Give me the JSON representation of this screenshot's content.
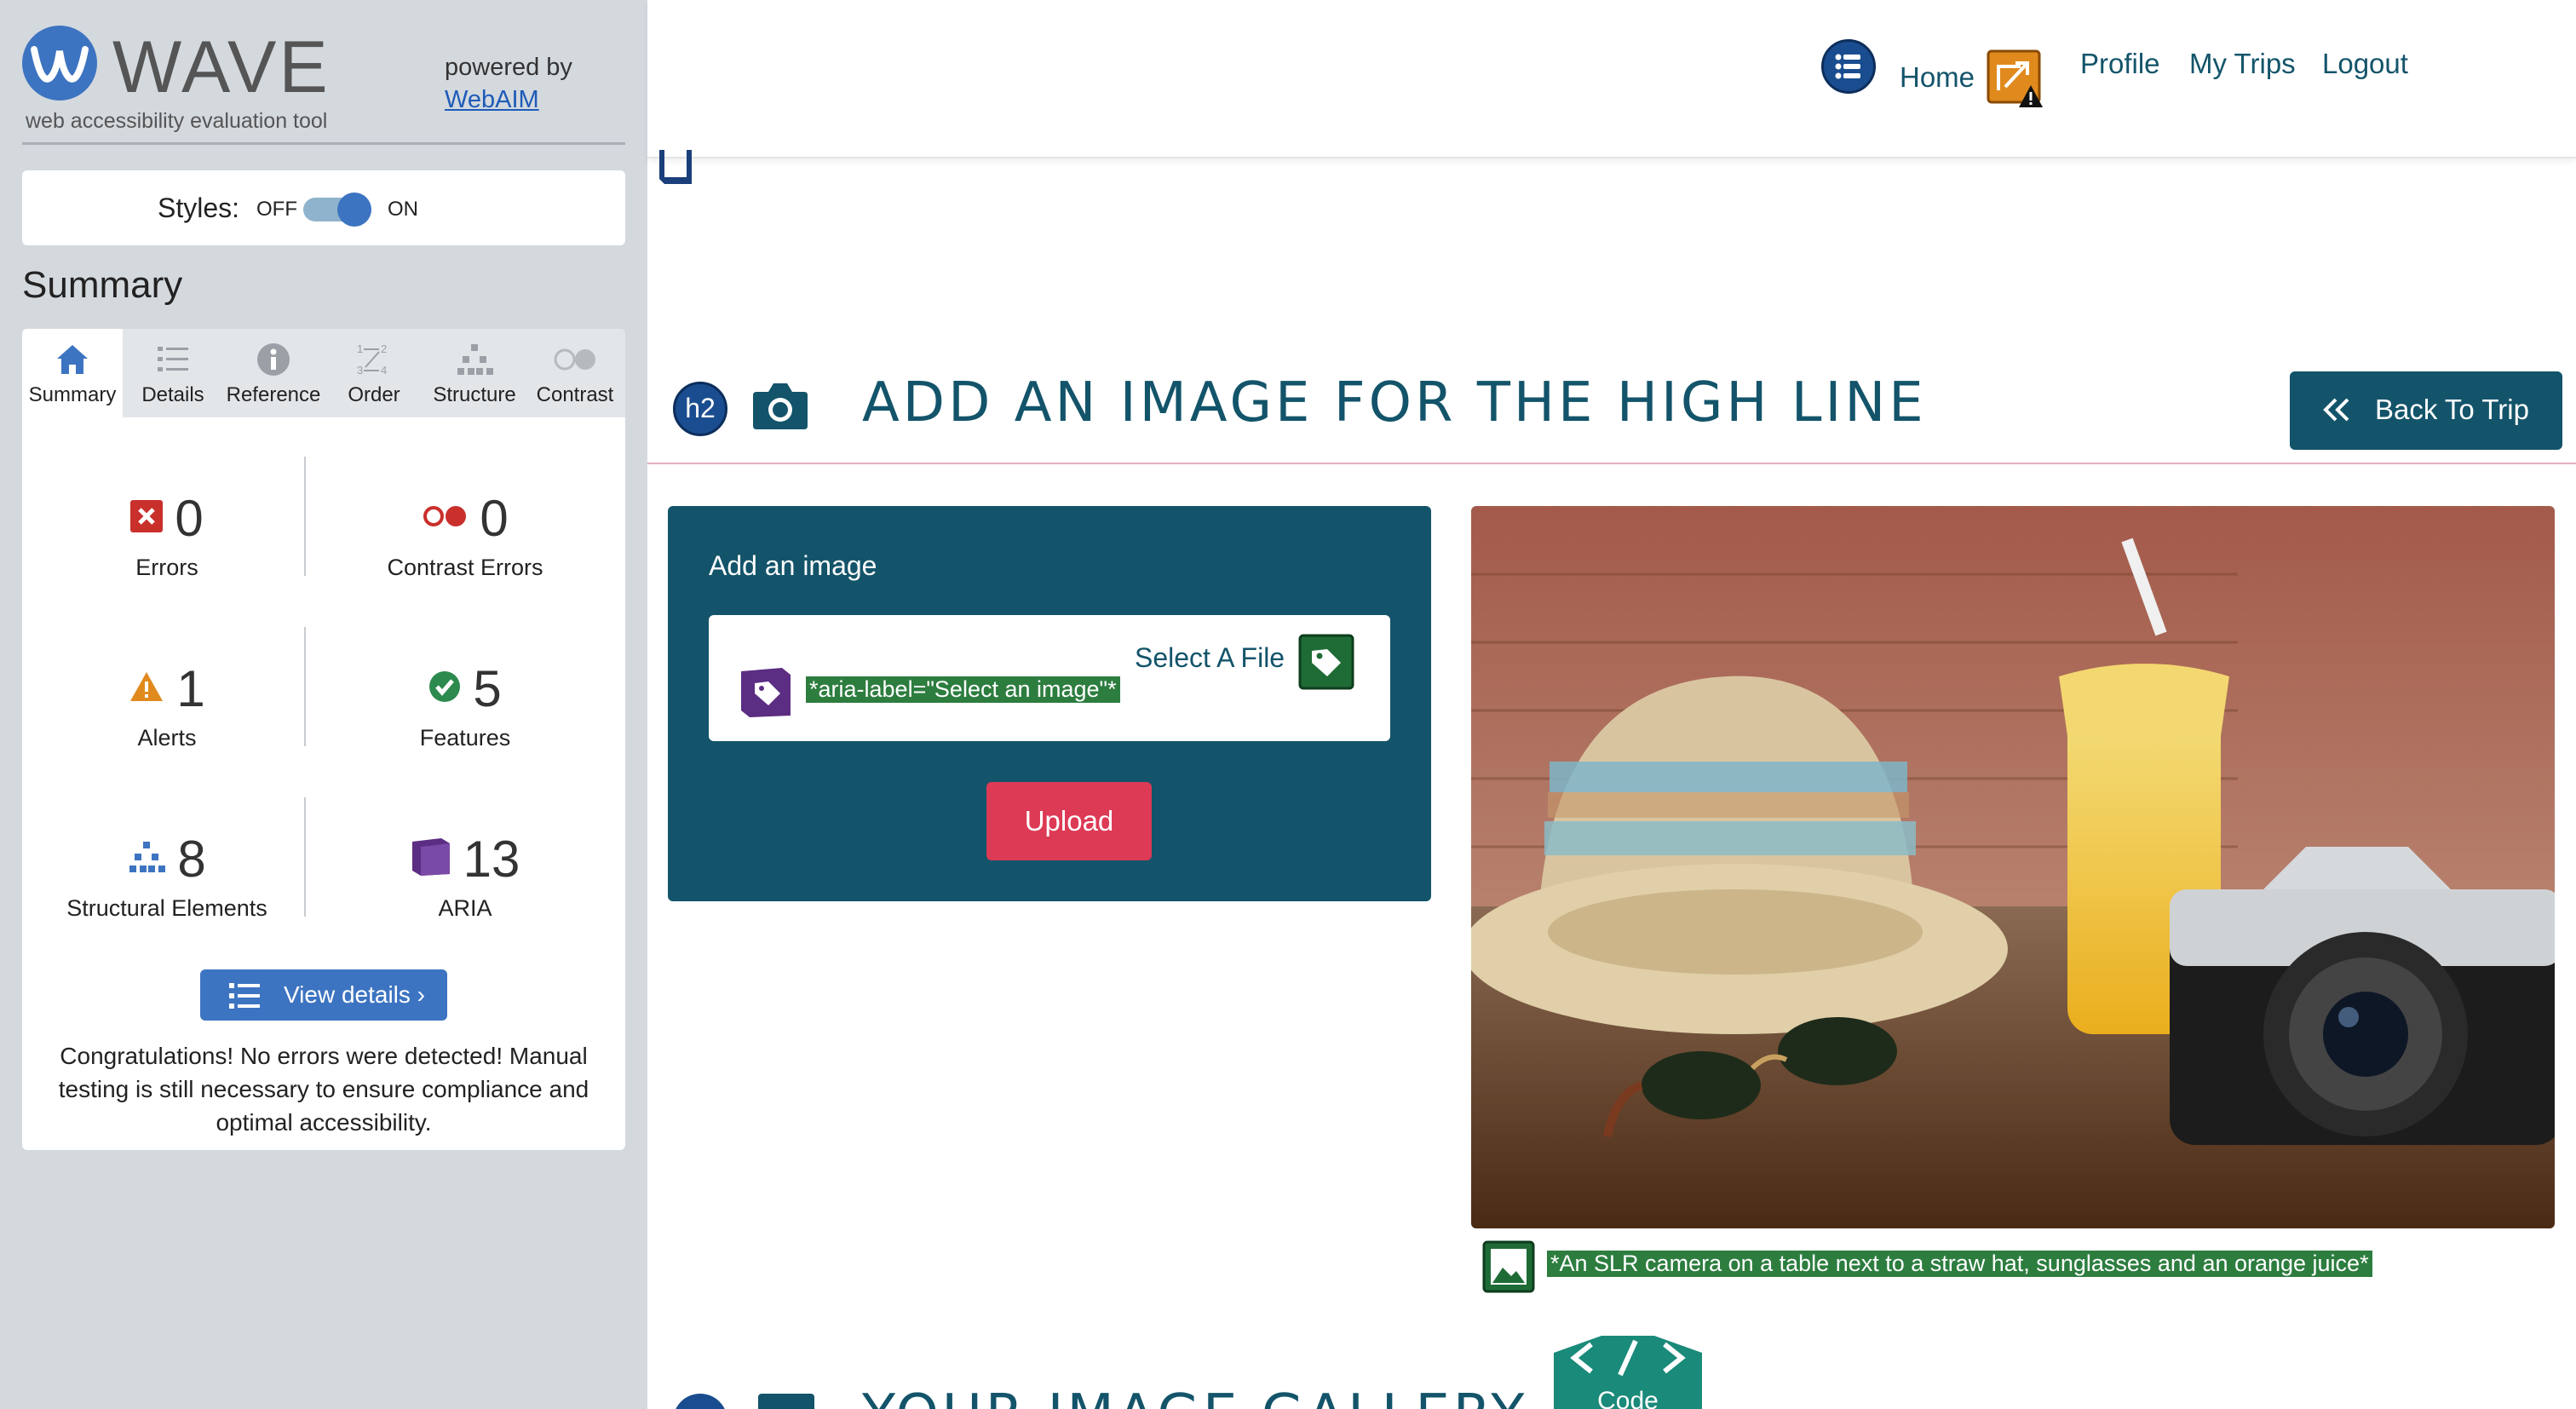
{
  "wave": {
    "title": "WAVE",
    "subtitle": "web accessibility evaluation tool",
    "powered_by": "powered by",
    "webaim_link": "WebAIM",
    "styles_label": "Styles:",
    "styles_off": "OFF",
    "styles_on": "ON",
    "styles_enabled": true,
    "summary_heading": "Summary",
    "tabs": [
      {
        "label": "Summary",
        "icon": "home-icon",
        "active": true
      },
      {
        "label": "Details",
        "icon": "list-icon",
        "active": false
      },
      {
        "label": "Reference",
        "icon": "info-icon",
        "active": false
      },
      {
        "label": "Order",
        "icon": "order-icon",
        "active": false
      },
      {
        "label": "Structure",
        "icon": "structure-icon",
        "active": false
      },
      {
        "label": "Contrast",
        "icon": "contrast-icon",
        "active": false
      }
    ],
    "stats": {
      "errors": {
        "count": "0",
        "label": "Errors",
        "icon": "error-icon"
      },
      "contrast_errors": {
        "count": "0",
        "label": "Contrast Errors",
        "icon": "contrast-error-icon"
      },
      "alerts": {
        "count": "1",
        "label": "Alerts",
        "icon": "alert-icon"
      },
      "features": {
        "count": "5",
        "label": "Features",
        "icon": "feature-icon"
      },
      "structural": {
        "count": "8",
        "label": "Structural Elements",
        "icon": "structure-icon"
      },
      "aria": {
        "count": "13",
        "label": "ARIA",
        "icon": "aria-icon"
      }
    },
    "view_details": "View details ›",
    "congrats": "Congratulations! No errors were detected! Manual testing is still necessary to ensure compliance and optimal accessibility."
  },
  "site": {
    "nav": {
      "home": "Home",
      "profile": "Profile",
      "my_trips": "My Trips",
      "logout": "Logout"
    },
    "h2_badge": "h2",
    "page_title": "Add an image for The High Line",
    "back_button": "Back To Trip",
    "form": {
      "heading": "Add an image",
      "select_file": "Select A File",
      "aria_label_note": "*aria-label=\"Select an image\"*",
      "upload_button": "Upload"
    },
    "photo_alt_note": "*An SLR camera on a table next to a straw hat, sunglasses and an orange juice*",
    "gallery_title": "Your Image Gallery",
    "code_badge": "Code"
  },
  "colors": {
    "wave_blue": "#3d74c1",
    "site_teal": "#13546a",
    "upload_red": "#dc3a55",
    "wave_green": "#2d7d3f",
    "aria_purple": "#5b2d83",
    "alert_orange": "#e08a1e",
    "error_red": "#c9302c"
  }
}
